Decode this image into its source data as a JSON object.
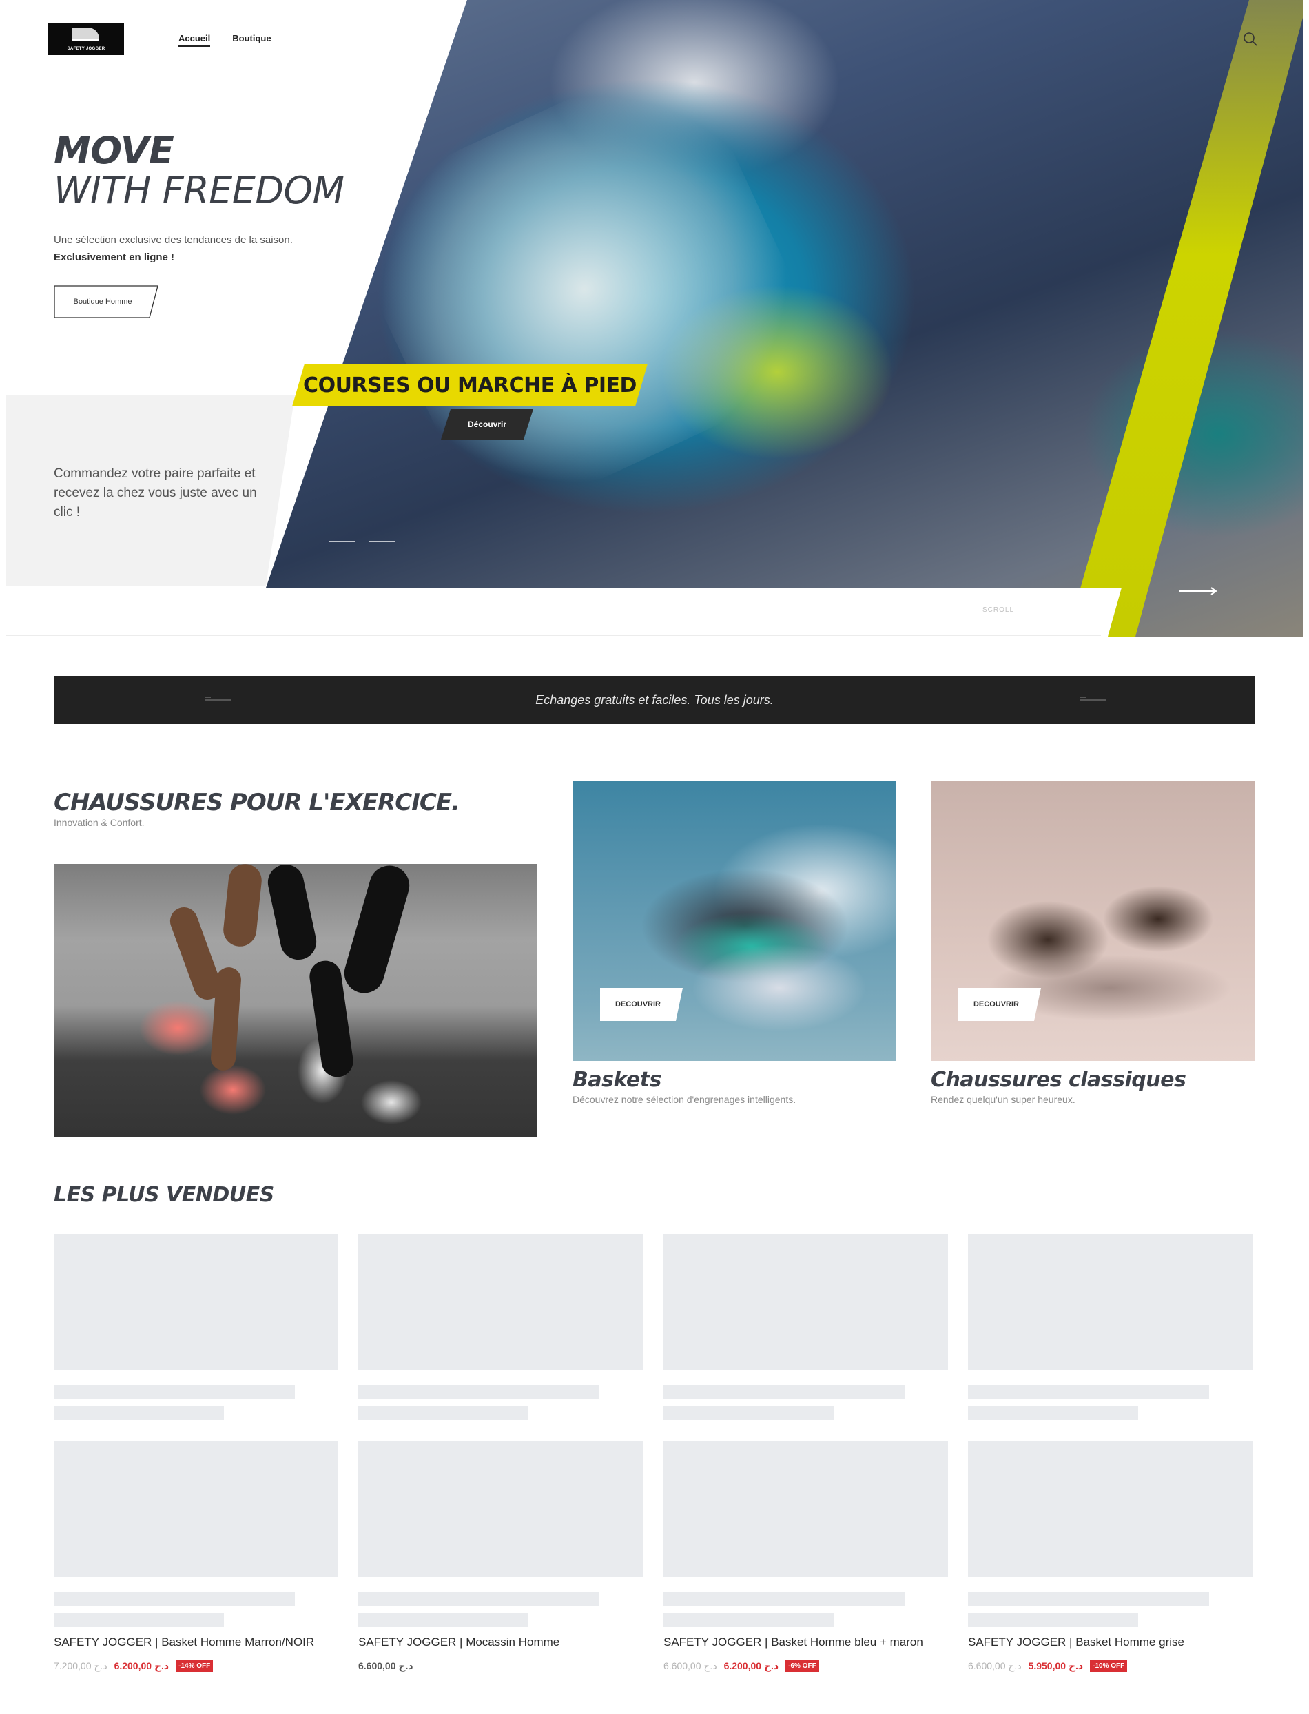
{
  "header": {
    "logo_text": "SAFETY JOGGER",
    "nav": [
      "Accueil",
      "Boutique"
    ]
  },
  "hero": {
    "title_bold": "MOVE",
    "title_light": "WITH FREEDOM",
    "description": "Une sélection exclusive des tendances de la saison.",
    "description_strong": "Exclusivement en ligne !",
    "cta_label": "Boutique Homme",
    "promo_text": "Commandez votre paire parfaite et recevez la chez vous juste avec un clic !",
    "slide_title": "COURSES OU MARCHE À PIED",
    "slide_cta": "Découvrir",
    "scroll_label": "SCROLL"
  },
  "info_bar": {
    "text": "Echanges gratuits et faciles. Tous les jours."
  },
  "categories": {
    "title": "CHAUSSURES POUR L'EXERCICE.",
    "subtitle": "Innovation & Confort.",
    "cards": [
      {
        "title": "Baskets",
        "subtitle": "Découvrez notre sélection d'engrenages intelligents.",
        "cta": "DECOUVRIR"
      },
      {
        "title": "Chaussures classiques",
        "subtitle": "Rendez quelqu'un super heureux.",
        "cta": "DECOUVRIR"
      }
    ]
  },
  "best_sellers": {
    "title": "LES PLUS VENDUES",
    "products": [
      {
        "name": "SAFETY JOGGER | Basket Homme Marron/NOIR",
        "old_price": "7.200,00 د.ج",
        "price": "6.200,00 د.ج",
        "discount": "-14% OFF"
      },
      {
        "name": "SAFETY JOGGER | Mocassin Homme",
        "old_price": "",
        "price": "6.600,00 د.ج",
        "discount": ""
      },
      {
        "name": "SAFETY JOGGER | Basket Homme bleu + maron",
        "old_price": "6.600,00 د.ج",
        "price": "6.200,00 د.ج",
        "discount": "-6% OFF"
      },
      {
        "name": "SAFETY JOGGER | Basket Homme grise",
        "old_price": "6.600,00 د.ج",
        "price": "5.950,00 د.ج",
        "discount": "-10% OFF"
      }
    ]
  },
  "colors": {
    "accent_yellow": "#e8d900",
    "discount_red": "#d92f34",
    "dark_bar": "#222222",
    "skeleton": "#e9ebee"
  }
}
